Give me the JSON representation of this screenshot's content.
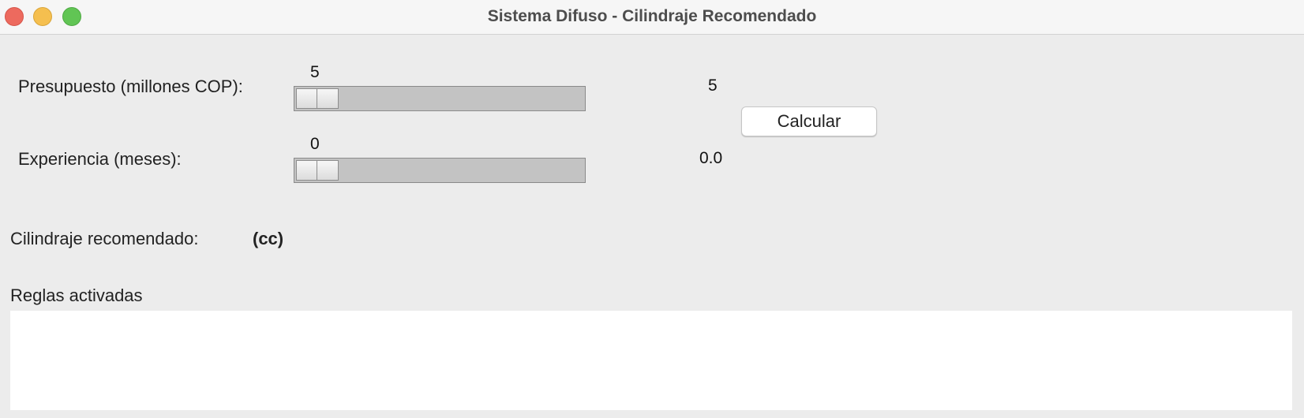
{
  "window": {
    "title": "Sistema Difuso - Cilindraje Recomendado"
  },
  "presupuesto": {
    "label": "Presupuesto (millones COP):",
    "slider_value": "5",
    "display_value": "5",
    "level": 0
  },
  "experiencia": {
    "label": "Experiencia (meses):",
    "slider_value": "0",
    "display_value": "0.0",
    "level": 0
  },
  "calcular_label": "Calcular",
  "result": {
    "label": "Cilindraje recomendado:",
    "value": "(cc)"
  },
  "rules": {
    "label": "Reglas activadas",
    "content": ""
  },
  "colors": {
    "close": "#ed6a5e",
    "minimize": "#f5bf4f",
    "maximize": "#61c554",
    "window_bg": "#ececec",
    "slider_trough": "#c3c3c3"
  }
}
